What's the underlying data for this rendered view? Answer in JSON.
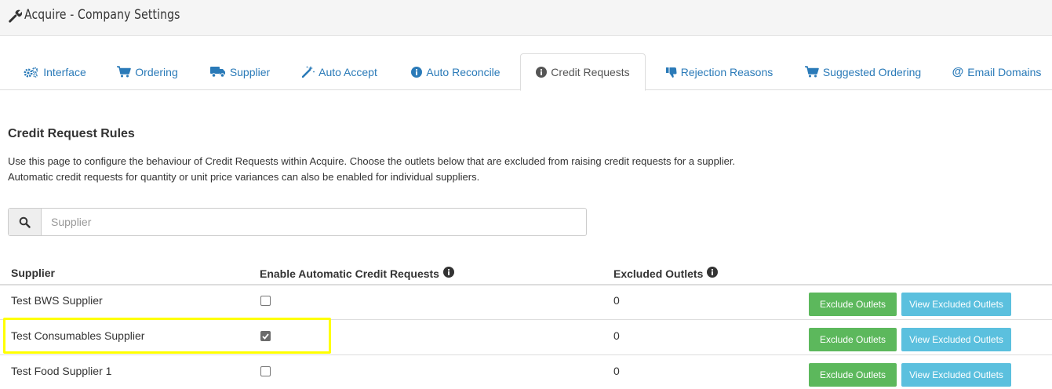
{
  "header": {
    "title": "Acquire - Company Settings",
    "icon": "wrench-icon"
  },
  "tabs": [
    {
      "label": "Interface",
      "icon": "cogs-icon"
    },
    {
      "label": "Ordering",
      "icon": "cart-icon"
    },
    {
      "label": "Supplier",
      "icon": "truck-icon"
    },
    {
      "label": "Auto Accept",
      "icon": "magic-wand-icon"
    },
    {
      "label": "Auto Reconcile",
      "icon": "info-circle-icon"
    },
    {
      "label": "Credit Requests",
      "icon": "info-circle-icon",
      "active": true
    },
    {
      "label": "Rejection Reasons",
      "icon": "thumbs-down-icon"
    },
    {
      "label": "Suggested Ordering",
      "icon": "cart-icon"
    },
    {
      "label": "Email Domains",
      "icon": "at-icon"
    }
  ],
  "section": {
    "title": "Credit Request Rules",
    "description_line1": "Use this page to configure the behaviour of Credit Requests within Acquire. Choose the outlets below that are excluded from raising credit requests for a supplier.",
    "description_line2": "Automatic credit requests for quantity or unit price variances can also be enabled for individual suppliers."
  },
  "search": {
    "placeholder": "Supplier",
    "value": ""
  },
  "table": {
    "headers": {
      "supplier": "Supplier",
      "auto_credit": "Enable Automatic Credit Requests",
      "excluded": "Excluded Outlets"
    },
    "rows": [
      {
        "supplier": "Test BWS Supplier",
        "auto_credit": false,
        "excluded": "0"
      },
      {
        "supplier": "Test Consumables Supplier",
        "auto_credit": true,
        "excluded": "0",
        "highlighted": true
      },
      {
        "supplier": "Test Food Supplier 1",
        "auto_credit": false,
        "excluded": "0"
      }
    ],
    "buttons": {
      "exclude": "Exclude Outlets",
      "view": "View Excluded Outlets"
    }
  },
  "colors": {
    "link": "#2a7ab8",
    "green_button": "#5cb85c",
    "blue_button": "#5bc0de",
    "highlight": "#ffff00"
  }
}
